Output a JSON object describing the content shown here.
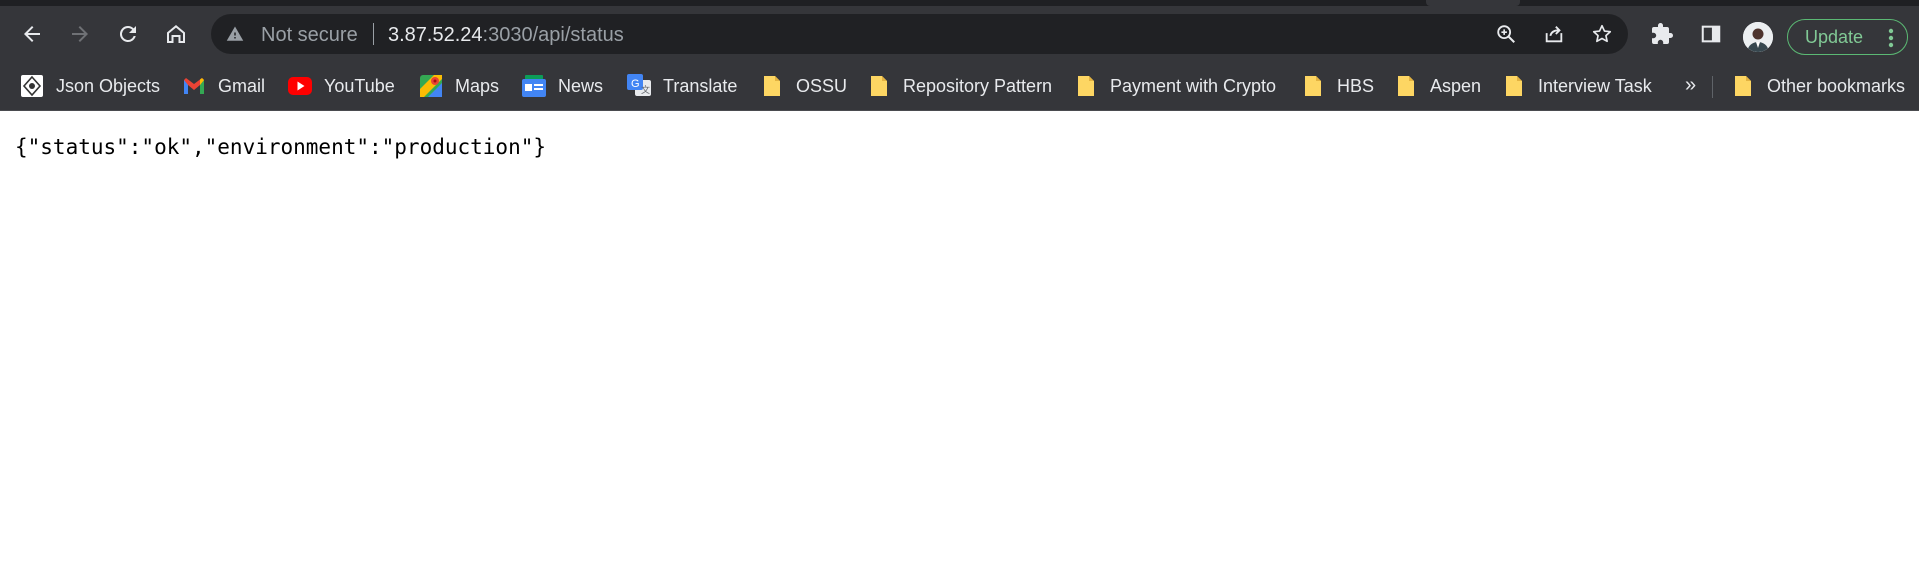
{
  "address_bar": {
    "security_label": "Not secure",
    "url_host": "3.87.52.24",
    "url_path": ":3030/api/status"
  },
  "toolbar": {
    "update_label": "Update"
  },
  "bookmarks": {
    "items": [
      {
        "label": "Json Objects",
        "icon": "json-objects-favicon"
      },
      {
        "label": "Gmail",
        "icon": "gmail-icon"
      },
      {
        "label": "YouTube",
        "icon": "youtube-icon"
      },
      {
        "label": "Maps",
        "icon": "maps-icon"
      },
      {
        "label": "News",
        "icon": "google-news-icon"
      },
      {
        "label": "Translate",
        "icon": "google-translate-icon"
      },
      {
        "label": "OSSU",
        "icon": "folder-icon"
      },
      {
        "label": "Repository Pattern",
        "icon": "folder-icon"
      },
      {
        "label": "Payment with Crypto",
        "icon": "folder-icon"
      },
      {
        "label": "HBS",
        "icon": "folder-icon"
      },
      {
        "label": "Aspen",
        "icon": "folder-icon"
      },
      {
        "label": "Interview Task",
        "icon": "folder-icon"
      }
    ],
    "overflow_label": "»",
    "other_label": "Other bookmarks"
  },
  "page": {
    "body_text": "{\"status\":\"ok\",\"environment\":\"production\"}"
  },
  "colors": {
    "chrome_bg": "#35363a",
    "omnibox_bg": "#202124",
    "update_green": "#81c995",
    "folder_yellow": "#fdd663"
  }
}
